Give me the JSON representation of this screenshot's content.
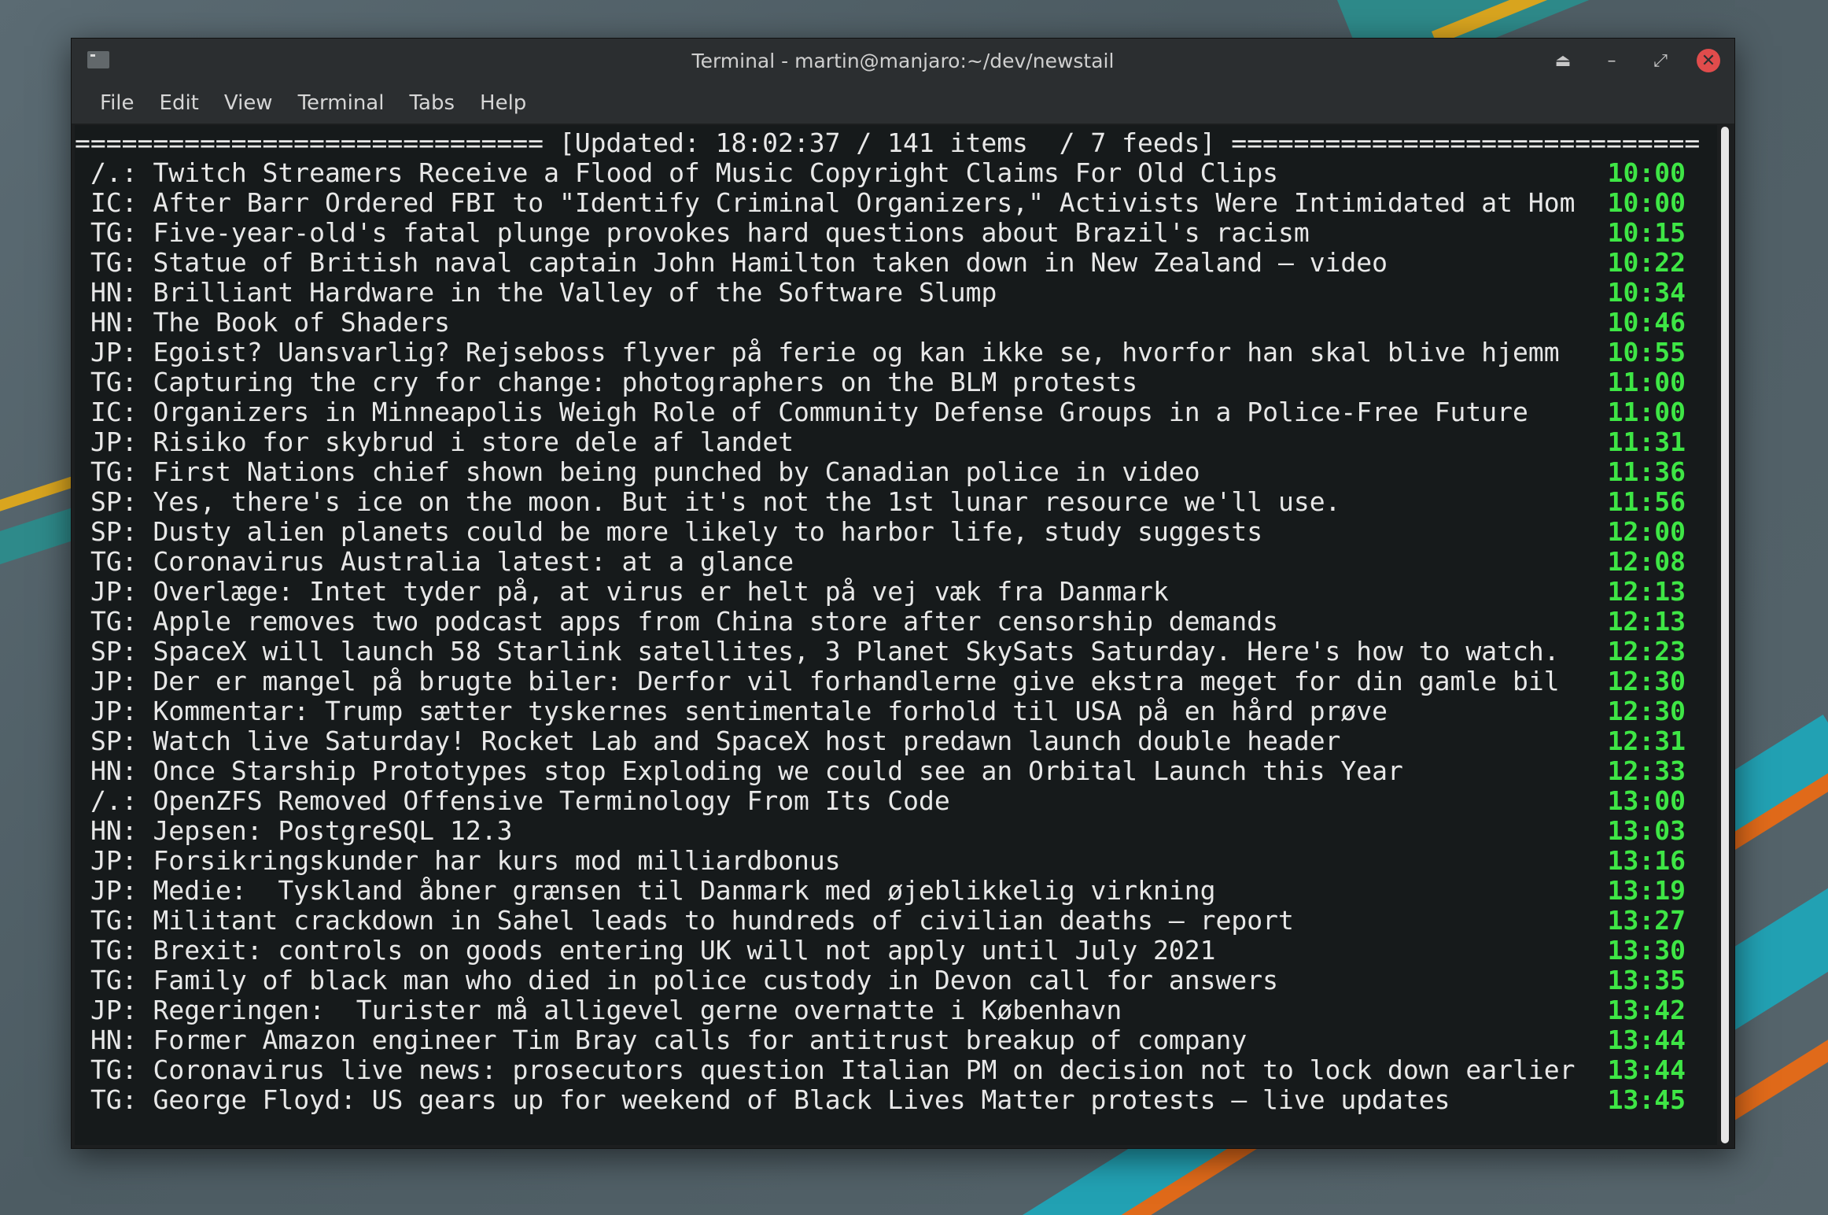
{
  "window": {
    "title": "Terminal - martin@manjaro:~/dev/newstail"
  },
  "menu": [
    "File",
    "Edit",
    "View",
    "Terminal",
    "Tabs",
    "Help"
  ],
  "status_line": "============================== [Updated: 18:02:37 / 141 items  / 7 feeds] ==============================",
  "colors": {
    "time": "#3ee645",
    "close": "#e04c4c",
    "terminal_bg": "#161a1b"
  },
  "feeds": [
    {
      "src": "/.:",
      "headline": "Twitch Streamers Receive a Flood of Music Copyright Claims For Old Clips",
      "time": "10:00"
    },
    {
      "src": "IC:",
      "headline": "After Barr Ordered FBI to \"Identify Criminal Organizers,\" Activists Were Intimidated at Hom",
      "time": "10:00"
    },
    {
      "src": "TG:",
      "headline": "Five-year-old's fatal plunge provokes hard questions about Brazil's racism",
      "time": "10:15"
    },
    {
      "src": "TG:",
      "headline": "Statue of British naval captain John Hamilton taken down in New Zealand – video",
      "time": "10:22"
    },
    {
      "src": "HN:",
      "headline": "Brilliant Hardware in the Valley of the Software Slump",
      "time": "10:34"
    },
    {
      "src": "HN:",
      "headline": "The Book of Shaders",
      "time": "10:46"
    },
    {
      "src": "JP:",
      "headline": "Egoist? Uansvarlig? Rejseboss flyver på ferie og kan ikke se, hvorfor han skal blive hjemm",
      "time": "10:55"
    },
    {
      "src": "TG:",
      "headline": "Capturing the cry for change: photographers on the BLM protests",
      "time": "11:00"
    },
    {
      "src": "IC:",
      "headline": "Organizers in Minneapolis Weigh Role of Community Defense Groups in a Police-Free Future",
      "time": "11:00"
    },
    {
      "src": "JP:",
      "headline": "Risiko for skybrud i store dele af landet",
      "time": "11:31"
    },
    {
      "src": "TG:",
      "headline": "First Nations chief shown being punched by Canadian police in video",
      "time": "11:36"
    },
    {
      "src": "SP:",
      "headline": "Yes, there's ice on the moon. But it's not the 1st lunar resource we'll use.",
      "time": "11:56"
    },
    {
      "src": "SP:",
      "headline": "Dusty alien planets could be more likely to harbor life, study suggests",
      "time": "12:00"
    },
    {
      "src": "TG:",
      "headline": "Coronavirus Australia latest: at a glance",
      "time": "12:08"
    },
    {
      "src": "JP:",
      "headline": "Overlæge: Intet tyder på, at virus er helt på vej væk fra Danmark",
      "time": "12:13"
    },
    {
      "src": "TG:",
      "headline": "Apple removes two podcast apps from China store after censorship demands",
      "time": "12:13"
    },
    {
      "src": "SP:",
      "headline": "SpaceX will launch 58 Starlink satellites, 3 Planet SkySats Saturday. Here's how to watch.",
      "time": "12:23"
    },
    {
      "src": "JP:",
      "headline": "Der er mangel på brugte biler: Derfor vil forhandlerne give ekstra meget for din gamle bil",
      "time": "12:30"
    },
    {
      "src": "JP:",
      "headline": "Kommentar: Trump sætter tyskernes sentimentale forhold til USA på en hård prøve",
      "time": "12:30"
    },
    {
      "src": "SP:",
      "headline": "Watch live Saturday! Rocket Lab and SpaceX host predawn launch double header",
      "time": "12:31"
    },
    {
      "src": "HN:",
      "headline": "Once Starship Prototypes stop Exploding we could see an Orbital Launch this Year",
      "time": "12:33"
    },
    {
      "src": "/.:",
      "headline": "OpenZFS Removed Offensive Terminology From Its Code",
      "time": "13:00"
    },
    {
      "src": "HN:",
      "headline": "Jepsen: PostgreSQL 12.3",
      "time": "13:03"
    },
    {
      "src": "JP:",
      "headline": "Forsikringskunder har kurs mod milliardbonus",
      "time": "13:16"
    },
    {
      "src": "JP:",
      "headline": "Medie:  Tyskland åbner grænsen til Danmark med øjeblikkelig virkning",
      "time": "13:19"
    },
    {
      "src": "TG:",
      "headline": "Militant crackdown in Sahel leads to hundreds of civilian deaths – report",
      "time": "13:27"
    },
    {
      "src": "TG:",
      "headline": "Brexit: controls on goods entering UK will not apply until July 2021",
      "time": "13:30"
    },
    {
      "src": "TG:",
      "headline": "Family of black man who died in police custody in Devon call for answers",
      "time": "13:35"
    },
    {
      "src": "JP:",
      "headline": "Regeringen:  Turister må alligevel gerne overnatte i København",
      "time": "13:42"
    },
    {
      "src": "HN:",
      "headline": "Former Amazon engineer Tim Bray calls for antitrust breakup of company",
      "time": "13:44"
    },
    {
      "src": "TG:",
      "headline": "Coronavirus live news: prosecutors question Italian PM on decision not to lock down earlier",
      "time": "13:44"
    },
    {
      "src": "TG:",
      "headline": "George Floyd: US gears up for weekend of Black Lives Matter protests – live updates",
      "time": "13:45"
    }
  ]
}
